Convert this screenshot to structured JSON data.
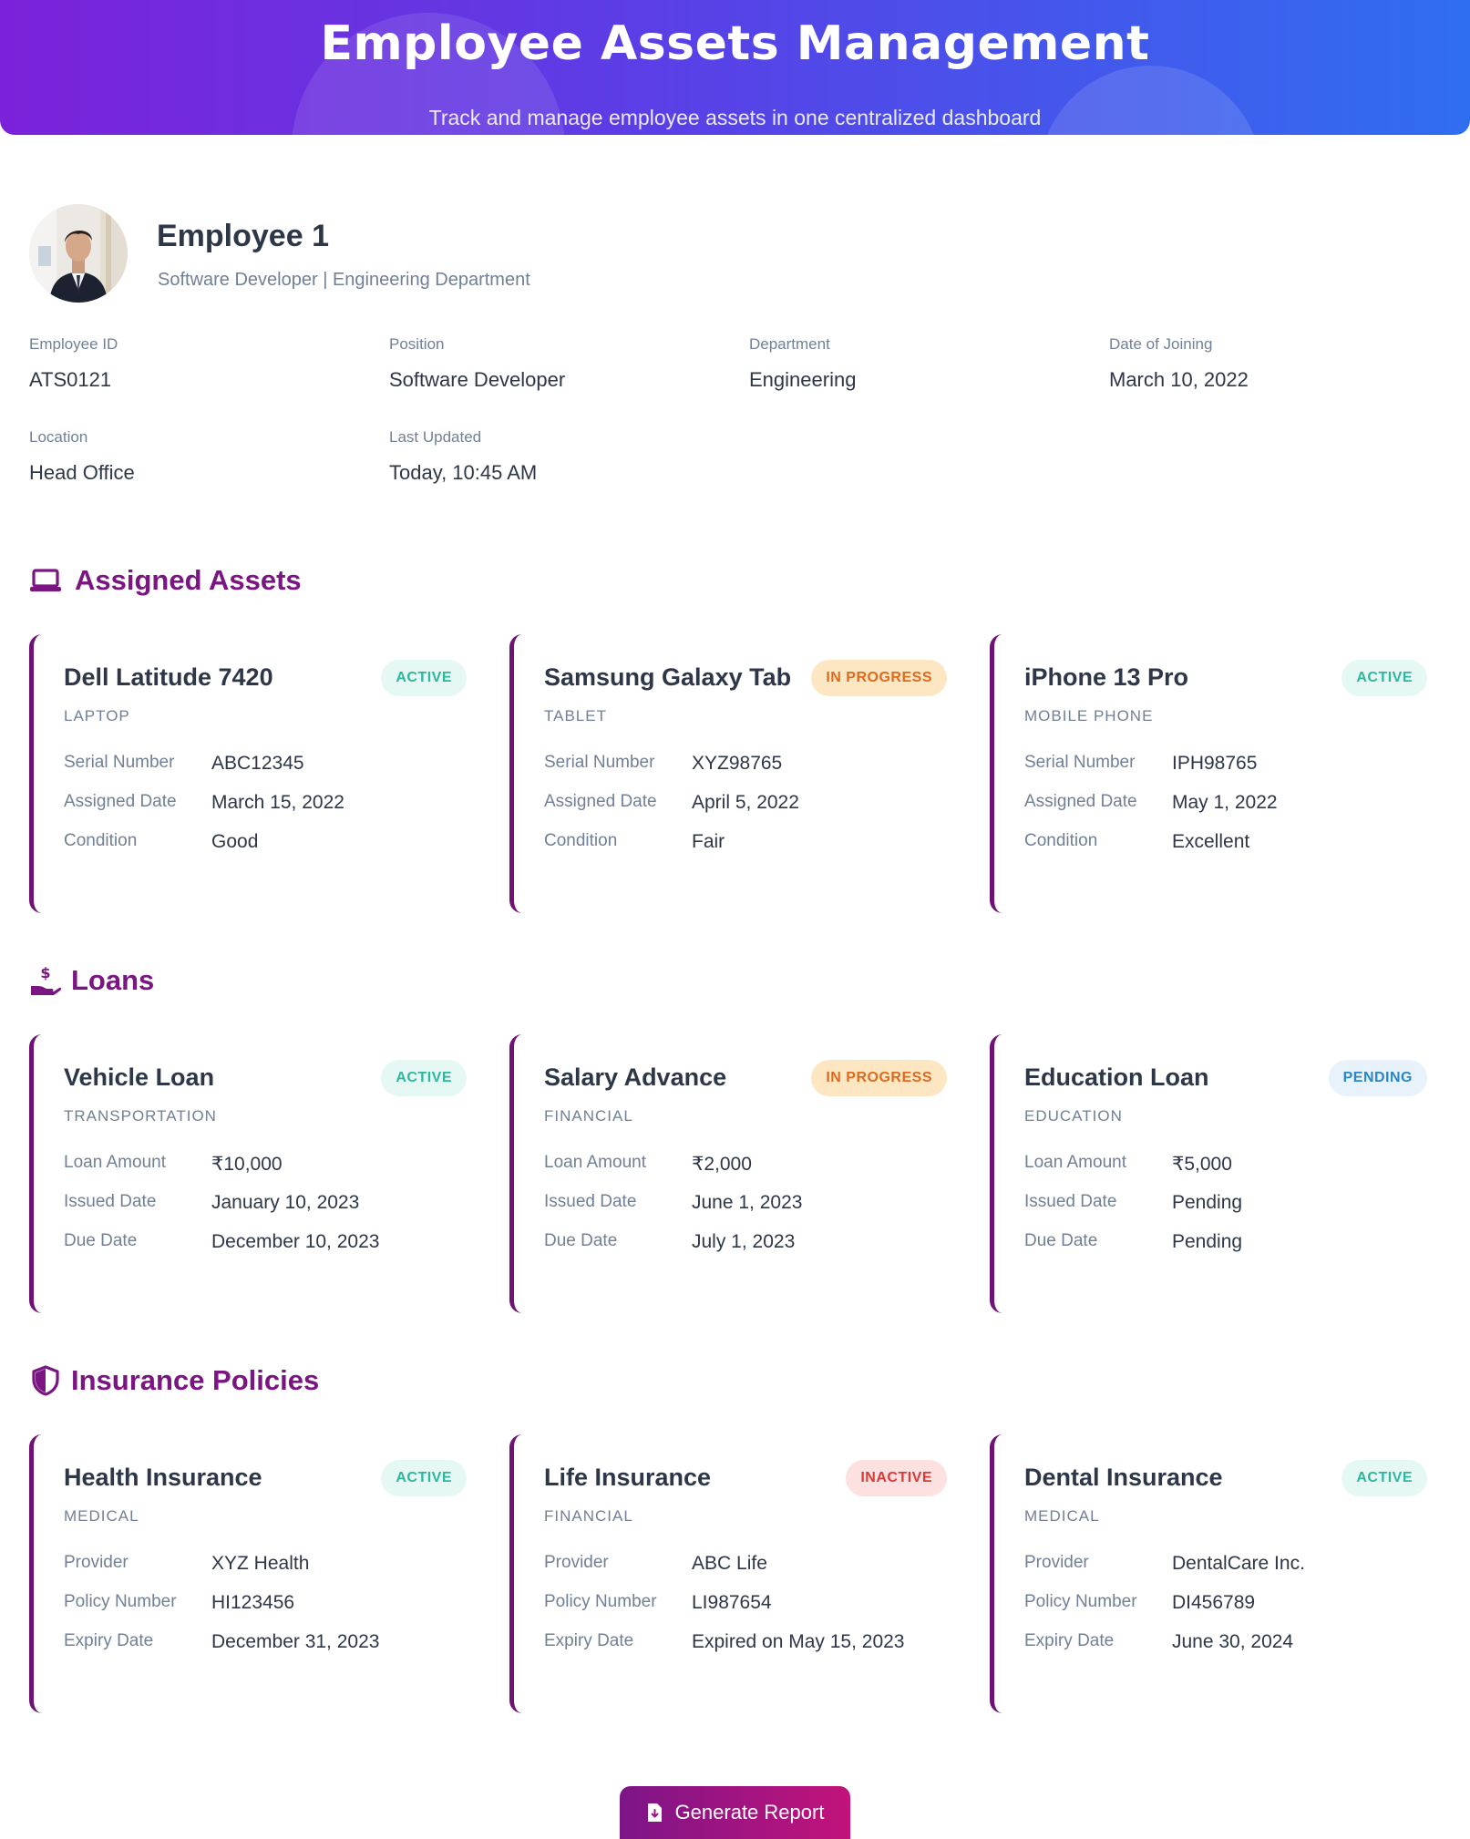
{
  "header": {
    "title": "Employee Assets Management",
    "subtitle": "Track and manage employee assets in one centralized dashboard"
  },
  "employee": {
    "name": "Employee 1",
    "subtitle": "Software Developer | Engineering Department",
    "info": [
      {
        "label": "Employee ID",
        "value": "ATS0121"
      },
      {
        "label": "Position",
        "value": "Software Developer"
      },
      {
        "label": "Department",
        "value": "Engineering"
      },
      {
        "label": "Date of Joining",
        "value": "March 10, 2022"
      },
      {
        "label": "Location",
        "value": "Head Office"
      },
      {
        "label": "Last Updated",
        "value": "Today, 10:45 AM"
      }
    ]
  },
  "sections": {
    "assets": {
      "title": "Assigned Assets",
      "icon": "laptop-icon",
      "cards": [
        {
          "title": "Dell Latitude 7420",
          "category": "LAPTOP",
          "status": "ACTIVE",
          "rows": [
            {
              "k": "Serial Number",
              "v": "ABC12345"
            },
            {
              "k": "Assigned Date",
              "v": "March 15, 2022"
            },
            {
              "k": "Condition",
              "v": "Good"
            }
          ]
        },
        {
          "title": "Samsung Galaxy Tab",
          "category": "TABLET",
          "status": "IN PROGRESS",
          "rows": [
            {
              "k": "Serial Number",
              "v": "XYZ98765"
            },
            {
              "k": "Assigned Date",
              "v": "April 5, 2022"
            },
            {
              "k": "Condition",
              "v": "Fair"
            }
          ]
        },
        {
          "title": "iPhone 13 Pro",
          "category": "MOBILE PHONE",
          "status": "ACTIVE",
          "rows": [
            {
              "k": "Serial Number",
              "v": "IPH98765"
            },
            {
              "k": "Assigned Date",
              "v": "May 1, 2022"
            },
            {
              "k": "Condition",
              "v": "Excellent"
            }
          ]
        }
      ]
    },
    "loans": {
      "title": "Loans",
      "icon": "hand-money-icon",
      "cards": [
        {
          "title": "Vehicle Loan",
          "category": "TRANSPORTATION",
          "status": "ACTIVE",
          "rows": [
            {
              "k": "Loan Amount",
              "v": "₹10,000"
            },
            {
              "k": "Issued Date",
              "v": "January 10, 2023"
            },
            {
              "k": "Due Date",
              "v": "December 10, 2023"
            }
          ]
        },
        {
          "title": "Salary Advance",
          "category": "FINANCIAL",
          "status": "IN PROGRESS",
          "rows": [
            {
              "k": "Loan Amount",
              "v": "₹2,000"
            },
            {
              "k": "Issued Date",
              "v": "June 1, 2023"
            },
            {
              "k": "Due Date",
              "v": "July 1, 2023"
            }
          ]
        },
        {
          "title": "Education Loan",
          "category": "EDUCATION",
          "status": "PENDING",
          "rows": [
            {
              "k": "Loan Amount",
              "v": "₹5,000"
            },
            {
              "k": "Issued Date",
              "v": "Pending"
            },
            {
              "k": "Due Date",
              "v": "Pending"
            }
          ]
        }
      ]
    },
    "insurance": {
      "title": "Insurance Policies",
      "icon": "shield-icon",
      "cards": [
        {
          "title": "Health Insurance",
          "category": "MEDICAL",
          "status": "ACTIVE",
          "rows": [
            {
              "k": "Provider",
              "v": "XYZ Health"
            },
            {
              "k": "Policy Number",
              "v": "HI123456"
            },
            {
              "k": "Expiry Date",
              "v": "December 31, 2023"
            }
          ]
        },
        {
          "title": "Life Insurance",
          "category": "FINANCIAL",
          "status": "INACTIVE",
          "rows": [
            {
              "k": "Provider",
              "v": "ABC Life"
            },
            {
              "k": "Policy Number",
              "v": "LI987654"
            },
            {
              "k": "Expiry Date",
              "v": "Expired on May 15, 2023"
            }
          ]
        },
        {
          "title": "Dental Insurance",
          "category": "MEDICAL",
          "status": "ACTIVE",
          "rows": [
            {
              "k": "Provider",
              "v": "DentalCare Inc."
            },
            {
              "k": "Policy Number",
              "v": "DI456789"
            },
            {
              "k": "Expiry Date",
              "v": "June 30, 2024"
            }
          ]
        }
      ]
    }
  },
  "actions": {
    "generate_report": "Generate Report",
    "generate_report_icon": "file-download-icon"
  },
  "colors": {
    "accent": "#7a1581",
    "header_start": "#7b22d9",
    "header_end": "#2f6ef0",
    "active": "#2fb79d",
    "in_progress": "#dd6a1f",
    "pending": "#2b86c6",
    "inactive": "#d83a3a"
  }
}
